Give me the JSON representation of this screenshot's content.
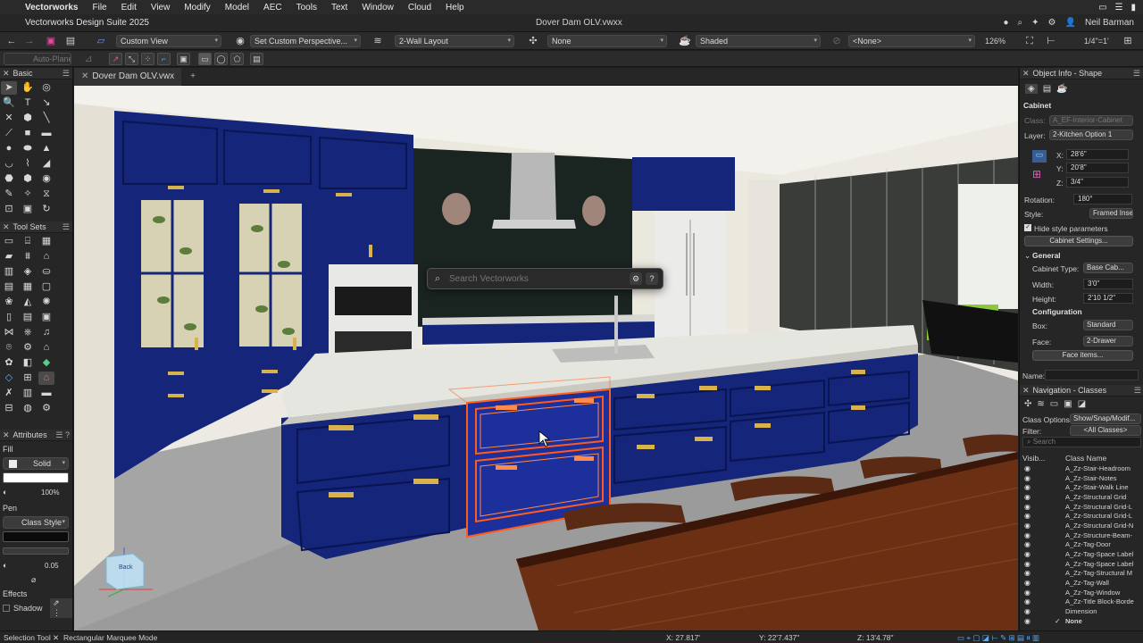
{
  "menubar": {
    "items": [
      "Vectorworks",
      "File",
      "Edit",
      "View",
      "Modify",
      "Model",
      "AEC",
      "Tools",
      "Text",
      "Window",
      "Cloud",
      "Help"
    ]
  },
  "titlebar": {
    "app_title": "Vectorworks Design Suite 2025",
    "document": "Dover Dam OLV.vwxx",
    "user": "Neil Barman"
  },
  "toolbar1": {
    "view": "Custom View",
    "perspective": "Set Custom Perspective...",
    "layout": "2-Wall Layout",
    "snap": "None",
    "render": "Shaded",
    "class": "<None>",
    "zoom": "126%",
    "scale": "1/4\"=1'"
  },
  "toolbar2": {
    "auto_plane": "Auto-Plane"
  },
  "doc_tab": {
    "name": "Dover Dam OLV.vwx"
  },
  "search": {
    "placeholder": "Search Vectorworks"
  },
  "left_panel": {
    "basic_title": "Basic",
    "toolsets_title": "Tool Sets",
    "attributes_title": "Attributes",
    "fill_label": "Fill",
    "fill_style": "Solid",
    "opacity": "100%",
    "pen_label": "Pen",
    "pen_style": "Class Style",
    "line_weight": "0.05",
    "effects_label": "Effects",
    "shadow_label": "Shadow"
  },
  "object_info": {
    "title": "Object Info - Shape",
    "object_type": "Cabinet",
    "class_label": "Class:",
    "class_value": "A_EF-Interior-Cabinet",
    "layer_label": "Layer:",
    "layer_value": "2-Kitchen Option 1",
    "x_label": "X:",
    "x_value": "28'6\"",
    "y_label": "Y:",
    "y_value": "20'8\"",
    "z_label": "Z:",
    "z_value": "3/4\"",
    "rotation_label": "Rotation:",
    "rotation_value": "180°",
    "style_label": "Style:",
    "style_value": "Framed Inse...",
    "hide_style": "Hide style parameters",
    "cabinet_settings": "Cabinet Settings...",
    "general_head": "General",
    "cabinet_type_label": "Cabinet Type:",
    "cabinet_type_value": "Base Cab...",
    "width_label": "Width:",
    "width_value": "3'0\"",
    "height_label": "Height:",
    "height_value": "2'10 1/2\"",
    "config_head": "Configuration",
    "box_label": "Box:",
    "box_value": "Standard",
    "face_label": "Face:",
    "face_value": "2-Drawer",
    "face_items": "Face items...",
    "name_label": "Name:"
  },
  "navigation": {
    "title": "Navigation - Classes",
    "class_options_label": "Class Options:",
    "class_options_value": "Show/Snap/Modif...",
    "filter_label": "Filter:",
    "filter_value": "<All Classes>",
    "search_placeholder": "Search",
    "col_visibility": "Visib...",
    "col_name": "Class Name",
    "rows": [
      "A_Zz-Stair-Headroom",
      "A_Zz-Stair-Notes",
      "A_Zz-Stair-Walk Line",
      "A_Zz-Structural Grid",
      "A_Zz-Structural Grid-L",
      "A_Zz-Structural Grid-L",
      "A_Zz-Structural Grid-N",
      "A_Zz-Structure-Beam-",
      "A_Zz-Tag-Door",
      "A_Zz-Tag-Space Label",
      "A_Zz-Tag-Space Label",
      "A_Zz-Tag-Structural M",
      "A_Zz-Tag-Wall",
      "A_Zz-Tag-Window",
      "A_Zz-Title Block-Borde",
      "Dimension",
      "None"
    ]
  },
  "statusbar": {
    "tool": "Selection Tool",
    "mode": "Rectangular Marquee Mode",
    "x": "X: 27.817'",
    "y": "Y: 22'7.437\"",
    "z": "Z: 13'4.78\""
  },
  "viewcube_label": "Back",
  "colors": {
    "cabinet_blue": "#14257a",
    "brass": "#d8b24a",
    "counter": "#e6e6e0",
    "selection": "#ff5a1f"
  }
}
